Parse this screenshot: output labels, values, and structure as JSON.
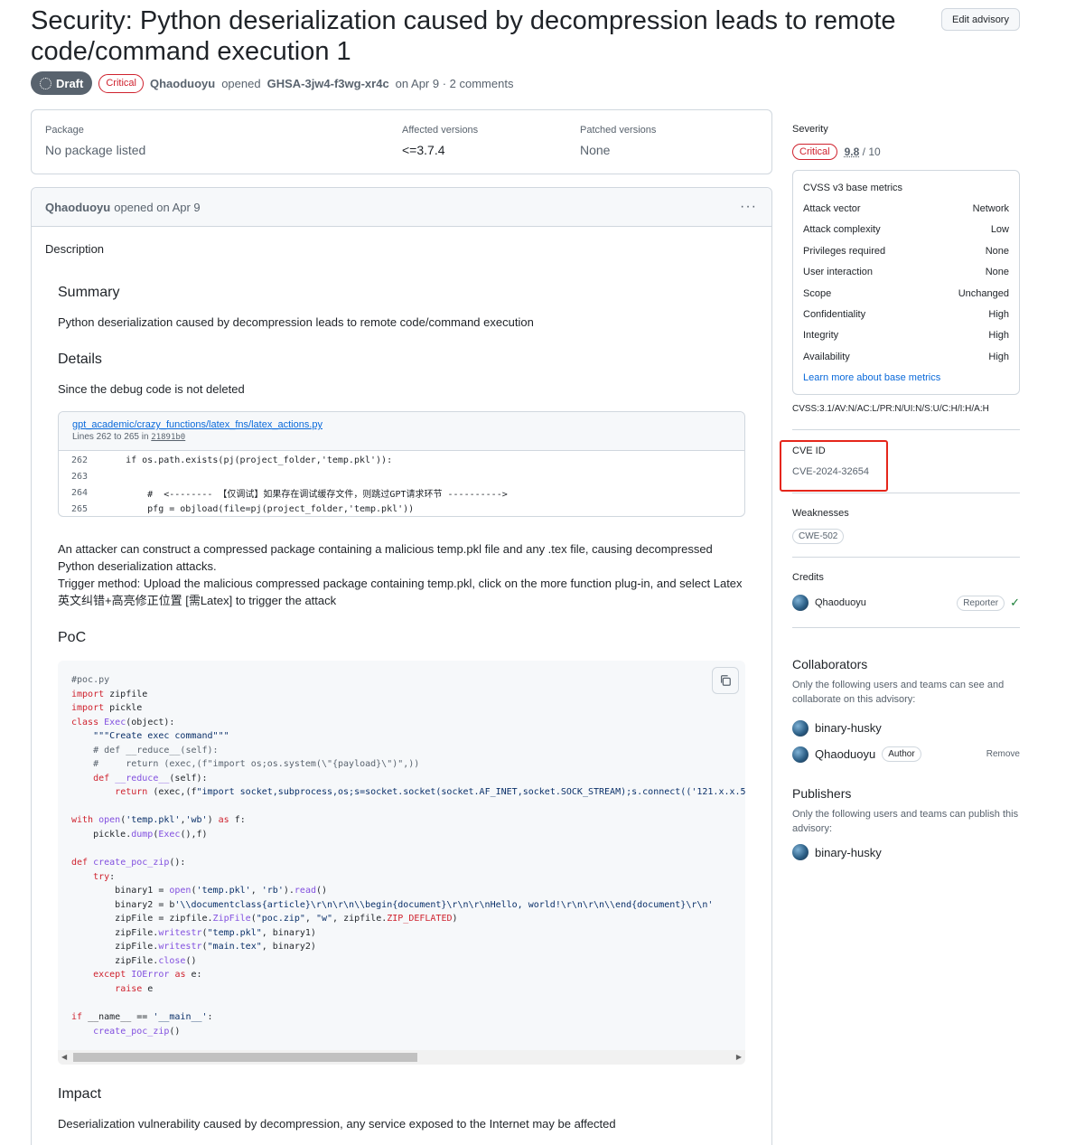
{
  "header": {
    "title": "Security: Python deserialization caused by decompression leads to remote code/command execution 1",
    "edit_button": "Edit advisory",
    "state": "Draft",
    "severity_badge": "Critical",
    "author": "Qhaoduoyu",
    "opened_text": "opened",
    "ghsa_id": "GHSA-3jw4-f3wg-xr4c",
    "date_text": "on Apr 9 · 2 comments"
  },
  "package": {
    "package_label": "Package",
    "package_value": "No package listed",
    "affected_label": "Affected versions",
    "affected_value": "<=3.7.4",
    "patched_label": "Patched versions",
    "patched_value": "None"
  },
  "comment": {
    "author": "Qhaoduoyu",
    "opened": "opened on Apr 9",
    "menu": "···",
    "description_label": "Description",
    "summary_heading": "Summary",
    "summary_text": "Python deserialization caused by decompression leads to remote code/command execution",
    "details_heading": "Details",
    "details_text": "Since the debug code is not deleted",
    "snippet": {
      "path": "gpt_academic/crazy_functions/latex_fns/latex_actions.py",
      "lines_text": "Lines 262 to 265 in",
      "commit": "21891b0",
      "lines": [
        {
          "n": "262",
          "code": "    if os.path.exists(pj(project_folder,'temp.pkl')):"
        },
        {
          "n": "263",
          "code": ""
        },
        {
          "n": "264",
          "code": "        #  <-------- 【仅调试】如果存在调试缓存文件，则跳过GPT请求环节 ---------->"
        },
        {
          "n": "265",
          "code": "        pfg = objload(file=pj(project_folder,'temp.pkl'))"
        }
      ]
    },
    "attack_text_1": "An attacker can construct a compressed package containing a malicious temp.pkl file and any .tex file, causing decompressed Python deserialization attacks.",
    "attack_text_2": "Trigger method: Upload the malicious compressed package containing temp.pkl, click on the more function plug-in, and select Latex英文纠错+高亮修正位置 [需Latex] to trigger the attack",
    "poc_heading": "PoC",
    "impact_heading": "Impact",
    "impact_text": "Deserialization vulnerability caused by decompression, any service exposed to the Internet may be affected"
  },
  "sidebar": {
    "severity_label": "Severity",
    "severity_badge": "Critical",
    "score": "9.8",
    "score_max": "/ 10",
    "cvss_title": "CVSS v3 base metrics",
    "metrics": [
      {
        "k": "Attack vector",
        "v": "Network"
      },
      {
        "k": "Attack complexity",
        "v": "Low"
      },
      {
        "k": "Privileges required",
        "v": "None"
      },
      {
        "k": "User interaction",
        "v": "None"
      },
      {
        "k": "Scope",
        "v": "Unchanged"
      },
      {
        "k": "Confidentiality",
        "v": "High"
      },
      {
        "k": "Integrity",
        "v": "High"
      },
      {
        "k": "Availability",
        "v": "High"
      }
    ],
    "learn_more": "Learn more about base metrics",
    "vector": "CVSS:3.1/AV:N/AC:L/PR:N/UI:N/S:U/C:H/I:H/A:H",
    "cve_label": "CVE ID",
    "cve_value": "CVE-2024-32654",
    "weaknesses_label": "Weaknesses",
    "weakness": "CWE-502",
    "credits_label": "Credits",
    "credit_user": "Qhaoduoyu",
    "credit_role": "Reporter",
    "collaborators_heading": "Collaborators",
    "collaborators_note": "Only the following users and teams can see and collaborate on this advisory:",
    "collaborators": [
      {
        "name": "binary-husky",
        "role": "",
        "action": ""
      },
      {
        "name": "Qhaoduoyu",
        "role": "Author",
        "action": "Remove"
      }
    ],
    "publishers_heading": "Publishers",
    "publishers_note": "Only the following users and teams can publish this advisory:",
    "publisher": "binary-husky"
  },
  "colors": {
    "critical": "#cf222e",
    "link": "#0969da",
    "highlight_box": "#e5261b"
  }
}
